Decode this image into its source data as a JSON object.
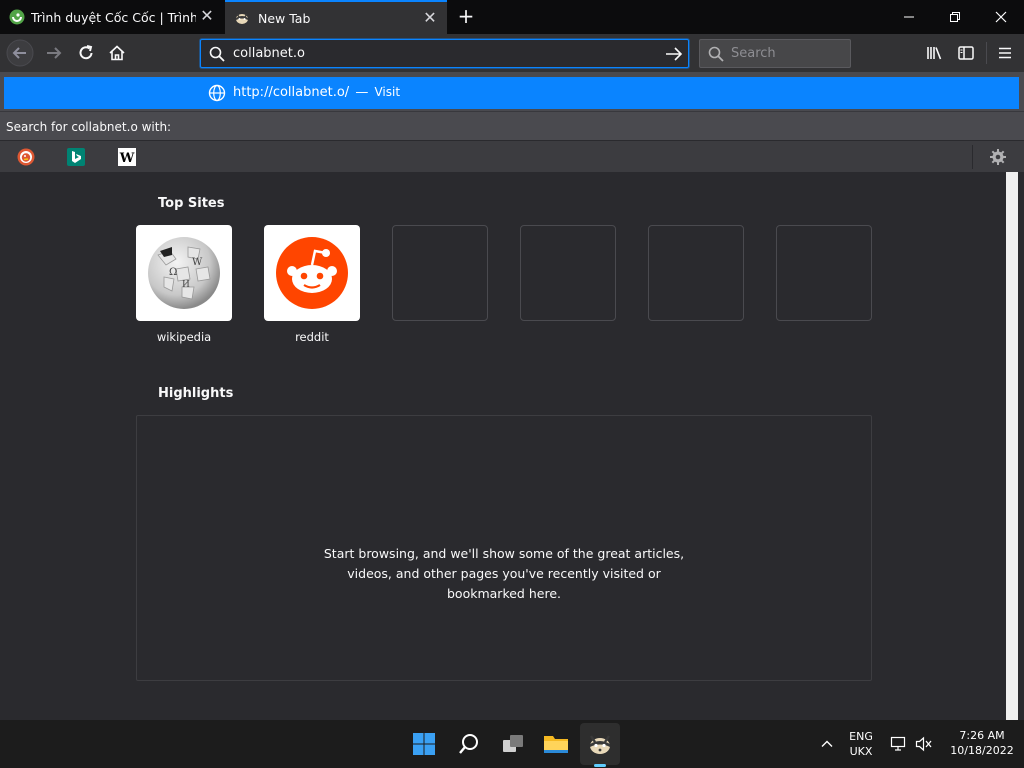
{
  "browser": {
    "tabs": [
      {
        "title": "Trình duyệt Cốc Cốc | Trình duyệt web",
        "active": false
      },
      {
        "title": "New Tab",
        "active": true
      }
    ],
    "toolbar": {
      "url_value": "collabnet.o",
      "search_placeholder": "Search"
    },
    "dropdown": {
      "visit_url": "http://collabnet.o/",
      "visit_dash": "—",
      "visit_action": "Visit",
      "search_with": "Search for collabnet.o with:",
      "engines": [
        "duckduckgo-icon",
        "bing-icon",
        "wikipedia-icon"
      ]
    }
  },
  "newtab": {
    "top_sites_title": "Top Sites",
    "top_sites": [
      {
        "label": "wikipedia",
        "icon": "wikipedia-globe-icon"
      },
      {
        "label": "reddit",
        "icon": "reddit-icon"
      },
      {
        "label": ""
      },
      {
        "label": ""
      },
      {
        "label": ""
      },
      {
        "label": ""
      }
    ],
    "highlights_title": "Highlights",
    "highlights_empty": "Start browsing, and we'll show some of the great articles, videos, and other pages you've recently visited or bookmarked here."
  },
  "taskbar": {
    "lang_top": "ENG",
    "lang_bottom": "UKX",
    "time": "7:26 AM",
    "date": "10/18/2022"
  },
  "colors": {
    "accent": "#0a84ff",
    "reddit": "#ff4500",
    "toolbar_bg": "#323234",
    "content_bg": "#2a2a2e"
  }
}
